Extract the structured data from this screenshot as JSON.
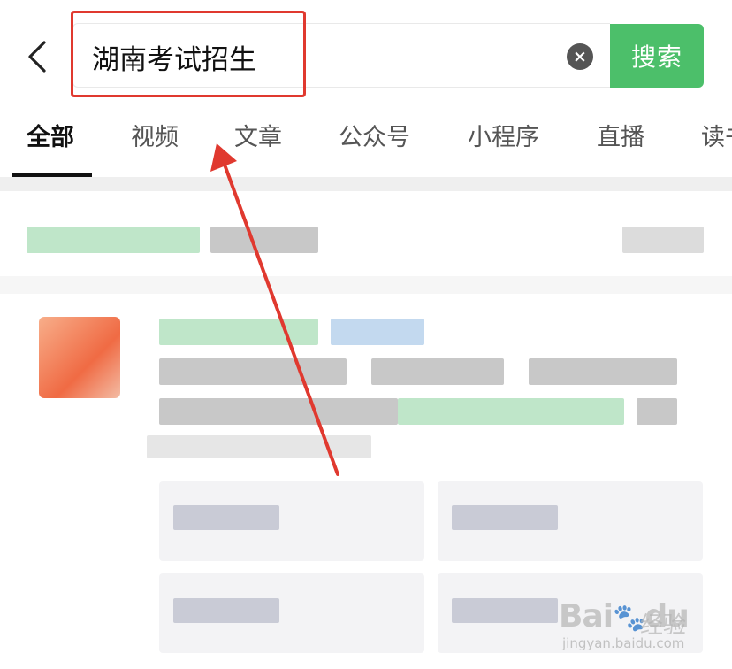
{
  "header": {
    "search_value": "湖南考试招生",
    "clear_symbol": "×",
    "search_button_label": "搜索"
  },
  "tabs": [
    {
      "label": "全部",
      "active": true
    },
    {
      "label": "视频",
      "active": false
    },
    {
      "label": "文章",
      "active": false
    },
    {
      "label": "公众号",
      "active": false
    },
    {
      "label": "小程序",
      "active": false
    },
    {
      "label": "直播",
      "active": false
    },
    {
      "label": "读书",
      "active": false
    }
  ],
  "watermark": {
    "brand": "Bai",
    "brand_suffix": "du",
    "subtitle": "经验",
    "url": "jingyan.baidu.com"
  },
  "colors": {
    "search_button": "#4cbf6a",
    "highlight": "#e0392f",
    "annotation_arrow": "#e0392f"
  }
}
